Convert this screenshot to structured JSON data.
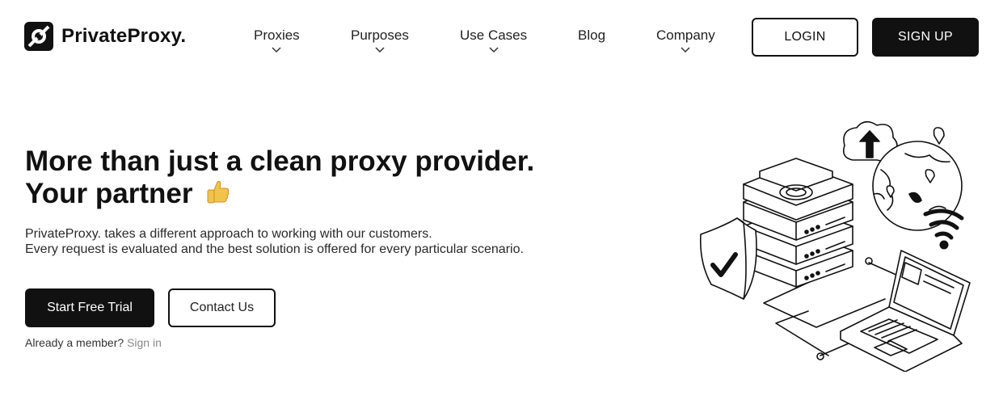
{
  "header": {
    "logo_text": "PrivateProxy.",
    "nav": [
      {
        "label": "Proxies",
        "has_dropdown": true
      },
      {
        "label": "Purposes",
        "has_dropdown": true
      },
      {
        "label": "Use Cases",
        "has_dropdown": true
      },
      {
        "label": "Blog",
        "has_dropdown": false
      },
      {
        "label": "Company",
        "has_dropdown": true
      }
    ],
    "login_label": "LOGIN",
    "signup_label": "SIGN UP"
  },
  "hero": {
    "title_line1": "More than just a clean proxy provider.",
    "title_line2": "Your partner",
    "title_emoji": "thumbs-up-icon",
    "desc_line1": "PrivateProxy. takes a different approach to working with our customers.",
    "desc_line2": "Every request is evaluated and the best solution is offered for every particular scenario.",
    "primary_cta": "Start Free Trial",
    "secondary_cta": "Contact Us",
    "member_text": "Already a member?",
    "signin_link": "Sign in"
  },
  "colors": {
    "primary": "#111111",
    "background": "#ffffff",
    "muted_link": "#8a8a8a",
    "emoji": "#f3c24a"
  },
  "illustration_icons": [
    "server-stack-icon",
    "shield-check-icon",
    "cloud-upload-icon",
    "globe-icon",
    "wifi-icon",
    "laptop-icon"
  ]
}
